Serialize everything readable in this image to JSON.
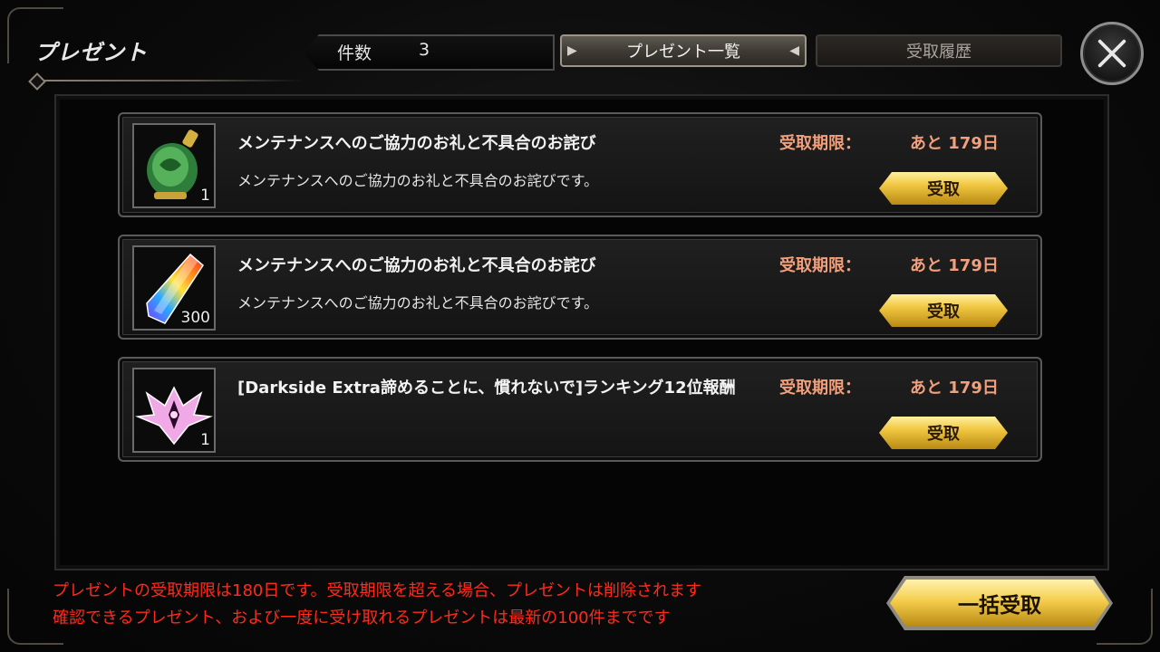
{
  "header": {
    "title": "プレゼント",
    "count_label": "件数",
    "count_value": "3",
    "tabs": [
      {
        "label": "プレゼント一覧",
        "active": true
      },
      {
        "label": "受取履歴",
        "active": false
      }
    ],
    "close_icon": "close-icon"
  },
  "items": [
    {
      "icon": "green-potion-icon",
      "quantity": "1",
      "title": "メンテナンスへのご協力のお礼と不具合のお詫び",
      "description": "メンテナンスへのご協力のお礼と不具合のお詫びです。",
      "deadline_label": "受取期限：",
      "deadline_value": "あと 179日",
      "receive_label": "受取"
    },
    {
      "icon": "rainbow-crystal-icon",
      "quantity": "300",
      "title": "メンテナンスへのご協力のお礼と不具合のお詫び",
      "description": "メンテナンスへのご協力のお礼と不具合のお詫びです。",
      "deadline_label": "受取期限：",
      "deadline_value": "あと 179日",
      "receive_label": "受取"
    },
    {
      "icon": "emblem-icon",
      "quantity": "1",
      "title": "[Darkside Extra諦めることに、慣れないで]ランキング12位報酬",
      "description": "",
      "deadline_label": "受取期限：",
      "deadline_value": "あと 179日",
      "receive_label": "受取"
    }
  ],
  "notices": [
    "プレゼントの受取期限は180日です。受取期限を超える場合、プレゼントは削除されます",
    "確認できるプレゼント、および一度に受け取れるプレゼントは最新の100件までです"
  ],
  "bulk_receive_label": "一括受取",
  "colors": {
    "deadline": "#f2a07c",
    "notice": "#ff2a1c",
    "gold_button": "#f0c640"
  }
}
